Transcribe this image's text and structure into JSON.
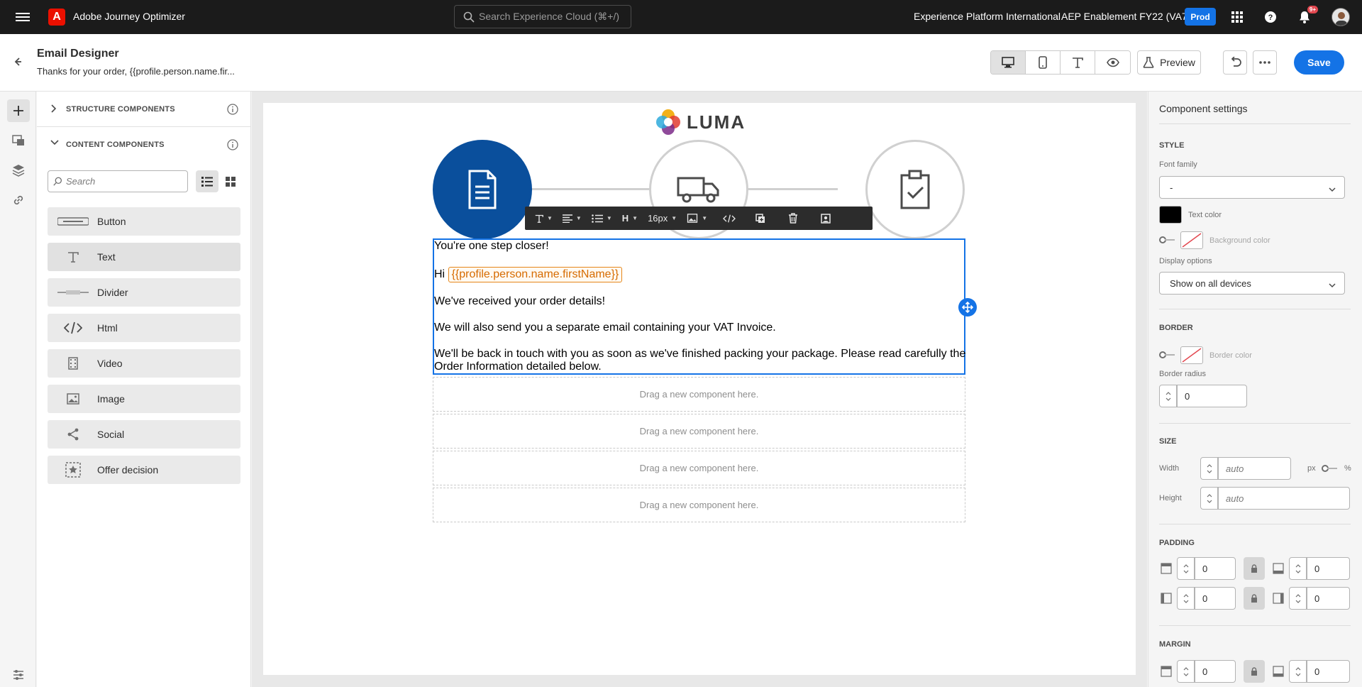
{
  "shell": {
    "app_name": "Adobe Journey Optimizer",
    "search_placeholder": "Search Experience Cloud (⌘+/)",
    "org_name": "Experience Platform International",
    "sandbox_name": "AEP Enablement FY22 (VA7)",
    "env_badge": "Prod",
    "notifications_count": "9+",
    "icons": [
      "menu-icon",
      "adobe-logo",
      "search-icon",
      "apps-icon",
      "help-icon",
      "bell-icon",
      "avatar"
    ]
  },
  "header": {
    "title": "Email Designer",
    "subtitle": "Thanks for your order, {{profile.person.name.fir...",
    "view_modes": [
      "desktop-icon",
      "mobile-icon",
      "text-icon",
      "eye-icon"
    ],
    "preview_label": "Preview",
    "save_label": "Save"
  },
  "left_panel": {
    "structure_label": "STRUCTURE COMPONENTS",
    "content_label": "CONTENT COMPONENTS",
    "search_placeholder": "Search",
    "components": [
      {
        "label": "Button",
        "icon": "button-icon"
      },
      {
        "label": "Text",
        "icon": "text-icon"
      },
      {
        "label": "Divider",
        "icon": "divider-icon"
      },
      {
        "label": "Html",
        "icon": "code-icon"
      },
      {
        "label": "Video",
        "icon": "video-icon"
      },
      {
        "label": "Image",
        "icon": "image-icon"
      },
      {
        "label": "Social",
        "icon": "share-icon"
      },
      {
        "label": "Offer decision",
        "icon": "offer-icon"
      }
    ]
  },
  "canvas": {
    "logo_text": "LUMA",
    "toolbar": {
      "font_size": "16px"
    },
    "text_lines": [
      "You're one step closer!",
      "Hi",
      "We've received your order details!",
      "We will also send you a separate email containing your VAT Invoice.",
      "We'll be back in touch with you as soon as we've finished packing your package. Please read carefully the",
      "Order Information detailed below."
    ],
    "personalization_token": "{{profile.person.name.firstName}}",
    "dropzone_label": "Drag a new component here."
  },
  "right_panel": {
    "title": "Component settings",
    "style_label": "STYLE",
    "font_family_label": "Font family",
    "font_family_value": "-",
    "text_color_label": "Text color",
    "text_color": "#000000",
    "background_color_label": "Background color",
    "display_options_label": "Display options",
    "display_options_value": "Show on all devices",
    "border_label": "BORDER",
    "border_color_label": "Border color",
    "border_radius_label": "Border radius",
    "border_radius_value": "0",
    "size_label": "SIZE",
    "width_label": "Width",
    "height_label": "Height",
    "auto_placeholder": "auto",
    "unit_px": "px",
    "unit_percent": "%",
    "padding_label": "PADDING",
    "padding_values": [
      "0",
      "0",
      "0",
      "0"
    ],
    "margin_label": "MARGIN",
    "margin_values": [
      "0",
      "0"
    ]
  },
  "colors": {
    "accent": "#1473e6",
    "step_active": "#0a4f9c",
    "token": "#d66b00"
  }
}
